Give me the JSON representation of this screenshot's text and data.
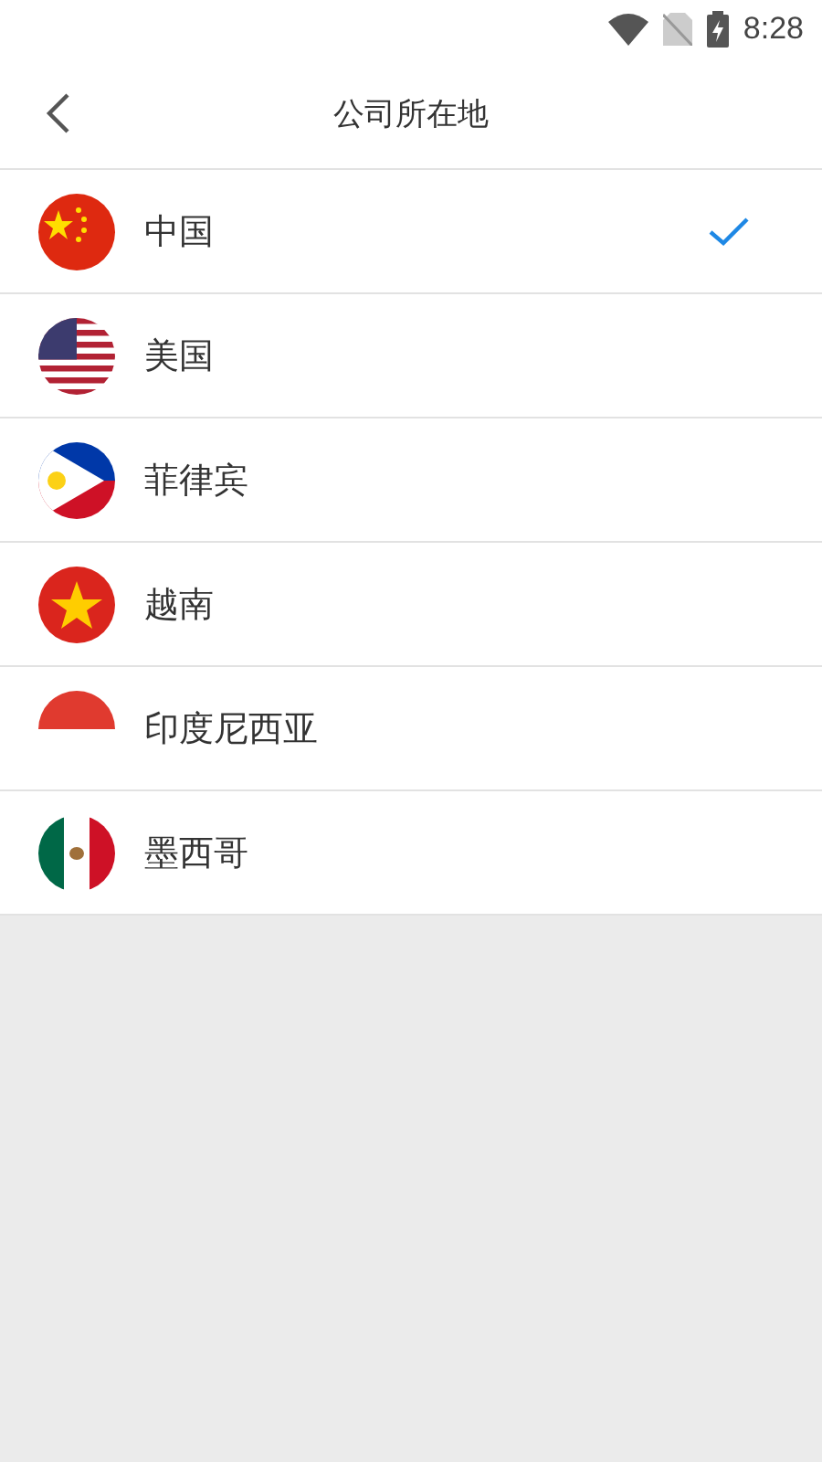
{
  "status_bar": {
    "time": "8:28"
  },
  "header": {
    "title": "公司所在地"
  },
  "countries": [
    {
      "name": "中国",
      "kind": "china",
      "selected": true
    },
    {
      "name": "美国",
      "kind": "usa",
      "selected": false
    },
    {
      "name": "菲律宾",
      "kind": "philippines",
      "selected": false
    },
    {
      "name": "越南",
      "kind": "vietnam",
      "selected": false
    },
    {
      "name": "印度尼西亚",
      "kind": "indonesia",
      "selected": false
    },
    {
      "name": "墨西哥",
      "kind": "mexico",
      "selected": false
    }
  ]
}
